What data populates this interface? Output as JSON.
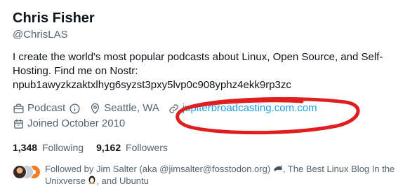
{
  "profile": {
    "name": "Chris Fisher",
    "handle": "@ChrisLAS",
    "bio_lines": [
      "I create the world's most popular podcasts about Linux, Open Source, and Self-",
      "Hosting. Find me on Nostr:",
      "npub1awyzkzaktxlhyg6syzst3pxy5lvp0c908yphz4ekk9rp3zc"
    ]
  },
  "meta": {
    "category": "Podcast",
    "location": "Seattle, WA",
    "website": "jupiterbroadcasting.com.com",
    "joined": "Joined October 2010"
  },
  "counts": {
    "following_value": "1,348",
    "following_label": "Following",
    "followers_value": "9,162",
    "followers_label": "Followers"
  },
  "followed_by": {
    "prefix": "Followed by Jim Salter (aka @jimsalter@fosstodon.org)",
    "middle": ", The Best Linux Blog In the Unixverse",
    "suffix": ", and Ubuntu"
  },
  "colors": {
    "link": "#1d9bf0",
    "secondary_text": "#536471",
    "annotation": "#e01e1e"
  },
  "icons": [
    "briefcase-icon",
    "info-icon",
    "location-pin-icon",
    "link-icon",
    "calendar-icon",
    "dolphin-emoji-icon",
    "penguin-emoji-icon"
  ]
}
